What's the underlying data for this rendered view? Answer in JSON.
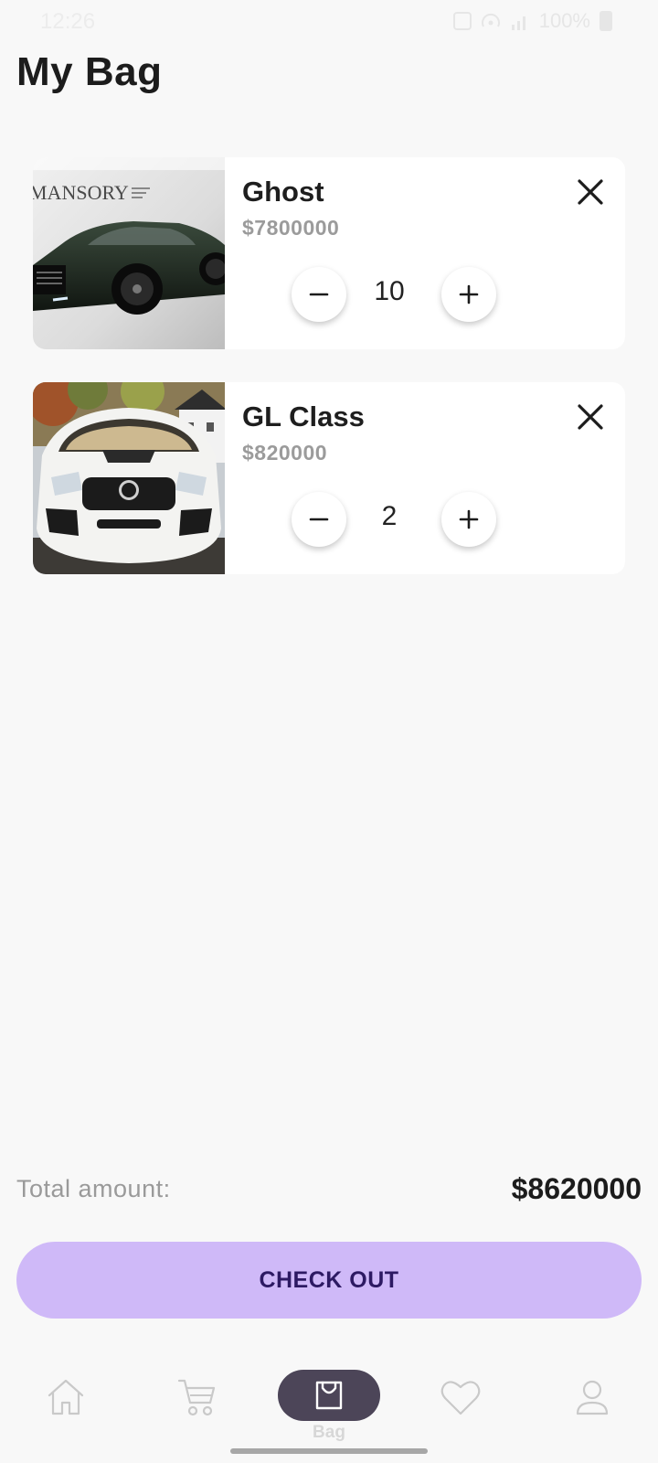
{
  "status_bar": {
    "time": "12:26",
    "battery": "100%"
  },
  "page": {
    "title": "My Bag"
  },
  "cart": {
    "items": [
      {
        "name": "Ghost",
        "price": "$7800000",
        "quantity": "10",
        "image_logo_text": "MANSORY"
      },
      {
        "name": "GL Class",
        "price": "$820000",
        "quantity": "2"
      }
    ]
  },
  "summary": {
    "total_label": "Total amount:",
    "total_value": "$8620000"
  },
  "checkout": {
    "label": "CHECK OUT"
  },
  "nav": {
    "items": [
      {
        "icon": "home-icon",
        "label": ""
      },
      {
        "icon": "cart-icon",
        "label": ""
      },
      {
        "icon": "bag-icon",
        "label": "Bag",
        "active": true
      },
      {
        "icon": "heart-icon",
        "label": ""
      },
      {
        "icon": "profile-icon",
        "label": ""
      }
    ]
  },
  "colors": {
    "background": "#f8f8f8",
    "checkout_bg": "#cfb9f8",
    "checkout_text": "#2d1a63",
    "nav_active_pill": "#4c4558",
    "price_text": "#9b9b9b"
  }
}
